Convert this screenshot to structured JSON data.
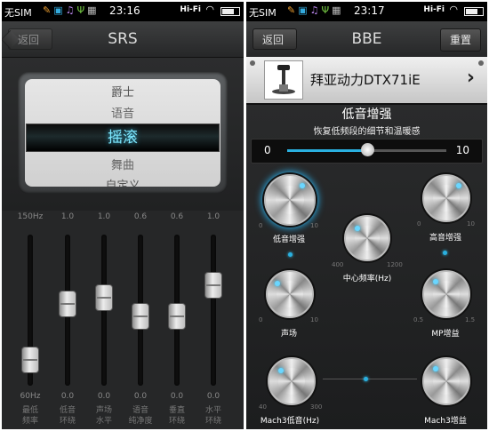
{
  "left": {
    "status": {
      "sim": "无SIM",
      "time": "23:16",
      "wifi": "Hi-Fi"
    },
    "header": {
      "back": "返回",
      "title": "SRS"
    },
    "presets": [
      "爵士",
      "语音",
      "摇滚",
      "舞曲",
      "自定义"
    ],
    "selected_preset": "摇滚",
    "eq": [
      {
        "top": "150Hz",
        "bottom": "60Hz",
        "label1": "最低",
        "label2": "频率",
        "level": 0.1
      },
      {
        "top": "1.0",
        "bottom": "0.0",
        "label1": "低音",
        "label2": "环绕",
        "level": 0.55
      },
      {
        "top": "1.0",
        "bottom": "0.0",
        "label1": "声场",
        "label2": "水平",
        "level": 0.6
      },
      {
        "top": "0.6",
        "bottom": "0.0",
        "label1": "语音",
        "label2": "纯净度",
        "level": 0.45
      },
      {
        "top": "0.6",
        "bottom": "0.0",
        "label1": "垂直",
        "label2": "环绕",
        "level": 0.45
      },
      {
        "top": "1.0",
        "bottom": "0.0",
        "label1": "水平",
        "label2": "环绕",
        "level": 0.7
      }
    ]
  },
  "right": {
    "status": {
      "sim": "无SIM",
      "time": "23:17",
      "wifi": "Hi-Fi"
    },
    "header": {
      "back": "返回",
      "title": "BBE",
      "reset": "重置"
    },
    "device": {
      "name": "拜亚动力DTX71iE"
    },
    "section": {
      "title": "低音增强",
      "desc": "恢复低频段的细节和温暖感"
    },
    "slider": {
      "min": "0",
      "max": "10",
      "value": 5
    },
    "knobs": {
      "bass": {
        "label": "低音增强",
        "min": "0",
        "max": "10"
      },
      "center": {
        "label": "中心频率(Hz)",
        "min": "400",
        "max": "1200"
      },
      "treble": {
        "label": "高音增强",
        "min": "0",
        "max": "10"
      },
      "soundfield": {
        "label": "声场",
        "min": "0",
        "max": "10"
      },
      "mp": {
        "label": "MP增益",
        "min": "0.5",
        "max": "1.5"
      },
      "mach3bass": {
        "label": "Mach3低音(Hz)",
        "min": "40",
        "max": "300"
      },
      "mach3gain": {
        "label": "Mach3增益",
        "min": "",
        "max": ""
      }
    }
  }
}
